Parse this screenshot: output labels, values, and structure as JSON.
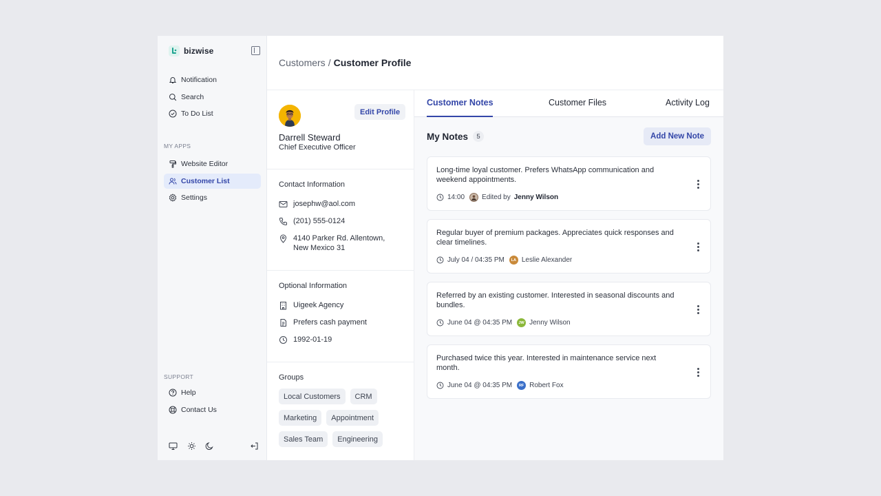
{
  "app": {
    "name": "bizwise"
  },
  "sidebar": {
    "top_items": [
      {
        "label": "Notification",
        "icon": "bell-icon"
      },
      {
        "label": "Search",
        "icon": "search-icon"
      },
      {
        "label": "To Do List",
        "icon": "check-circle-icon"
      }
    ],
    "my_apps_title": "MY APPS",
    "app_items": [
      {
        "label": "Website Editor",
        "icon": "paint-roller-icon"
      },
      {
        "label": "Customer List",
        "icon": "users-icon",
        "active": true
      },
      {
        "label": "Settings",
        "icon": "gear-icon"
      }
    ],
    "support_title": "SUPPORT",
    "support_items": [
      {
        "label": "Help",
        "icon": "help-circle-icon"
      },
      {
        "label": "Contact Us",
        "icon": "lifebuoy-icon"
      }
    ]
  },
  "header": {
    "parent": "Customers",
    "separator": "/",
    "current": "Customer Profile"
  },
  "profile": {
    "edit_label": "Edit Profile",
    "name": "Darrell Steward",
    "title": "Chief Executive Officer",
    "contact_title": "Contact Information",
    "email": "josephw@aol.com",
    "phone": "(201) 555-0124",
    "address": "4140 Parker Rd. Allentown, New Mexico 31",
    "optional_title": "Optional Information",
    "company": "Uigeek Agency",
    "payment": "Prefers cash payment",
    "birthday": "1992-01-19",
    "groups_title": "Groups",
    "groups": [
      "Local Customers",
      "CRM",
      "Marketing",
      "Appointment",
      "Sales Team",
      "Engineering"
    ]
  },
  "tabs": [
    "Customer Notes",
    "Customer Files",
    "Activity Log"
  ],
  "notes": {
    "title": "My Notes",
    "count": "5",
    "add_label": "Add New Note",
    "items": [
      {
        "text": "Long-time loyal customer. Prefers WhatsApp communication and weekend appointments.",
        "time": "14:00",
        "edited_by_prefix": "Edited by",
        "author": "Jenny Wilson",
        "avatar_color": "#8a6e5a",
        "initials": ""
      },
      {
        "text": "Regular buyer of premium packages. Appreciates quick responses and clear timelines.",
        "time": "July 04 / 04:35 PM",
        "edited_by_prefix": "",
        "author": "Leslie Alexander",
        "avatar_color": "#c98a3a",
        "initials": "LA"
      },
      {
        "text": "Referred by an existing customer. Interested in seasonal discounts and bundles.",
        "time": "June 04 @ 04:35 PM",
        "edited_by_prefix": "",
        "author": "Jenny Wilson",
        "avatar_color": "#8bb83a",
        "initials": "JW"
      },
      {
        "text": "Purchased twice this year. Interested in maintenance service next month.",
        "time": "June 04 @ 04:35 PM",
        "edited_by_prefix": "",
        "author": "Robert Fox",
        "avatar_color": "#3a6fc9",
        "initials": "RF"
      }
    ]
  },
  "colors": {
    "accent": "#3346a8",
    "active_bg": "#e4ebfb",
    "brand": "#1aa38f"
  }
}
